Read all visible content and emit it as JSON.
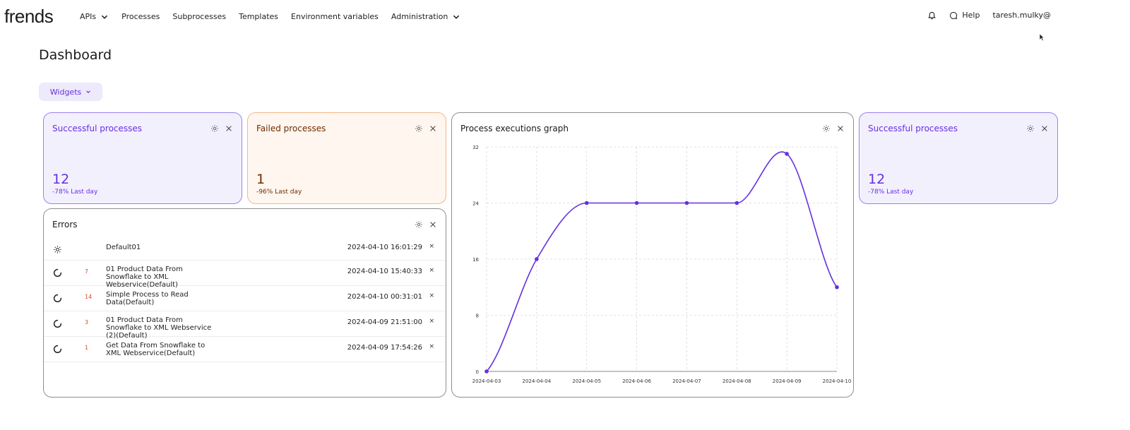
{
  "app": {
    "logo": "frends"
  },
  "nav": {
    "items": [
      {
        "label": "APIs",
        "has_menu": true
      },
      {
        "label": "Processes",
        "has_menu": false
      },
      {
        "label": "Subprocesses",
        "has_menu": false
      },
      {
        "label": "Templates",
        "has_menu": false
      },
      {
        "label": "Environment variables",
        "has_menu": false
      },
      {
        "label": "Administration",
        "has_menu": true
      }
    ],
    "help": "Help",
    "user": "taresh.mulky@"
  },
  "page": {
    "title": "Dashboard"
  },
  "toolbar": {
    "widgets_label": "Widgets"
  },
  "widgets": {
    "success1": {
      "title": "Successful processes",
      "value": "12",
      "sub": "-78% Last day"
    },
    "failed": {
      "title": "Failed processes",
      "value": "1",
      "sub": "-96% Last day"
    },
    "graph": {
      "title": "Process executions graph"
    },
    "success2": {
      "title": "Successful processes",
      "value": "12",
      "sub": "-78% Last day"
    },
    "errors": {
      "title": "Errors",
      "rows": [
        {
          "icon": "gear-icon",
          "count": "",
          "name": "Default01",
          "time": "2024-04-10 16:01:29"
        },
        {
          "icon": "loading-icon",
          "count": "7",
          "name": "01 Product Data From Snowflake to XML Webservice(Default)",
          "time": "2024-04-10 15:40:33"
        },
        {
          "icon": "loading-icon",
          "count": "14",
          "name": "Simple Process to Read Data(Default)",
          "time": "2024-04-10 00:31:01"
        },
        {
          "icon": "loading-icon",
          "count": "3",
          "name": "01 Product Data From Snowflake to XML Webservice (2)(Default)",
          "time": "2024-04-09 21:51:00"
        },
        {
          "icon": "loading-icon",
          "count": "1",
          "name": "Get Data From Snowflake to XML Webservice(Default)",
          "time": "2024-04-09 17:54:26"
        }
      ],
      "close_glyph": "×"
    }
  },
  "colors": {
    "accent": "#6530e0",
    "failed": "#6e2c00",
    "error_count": "#e0442c"
  },
  "chart_data": {
    "type": "line",
    "title": "Process executions graph",
    "x": [
      "2024-04-03",
      "2024-04-04",
      "2024-04-05",
      "2024-04-06",
      "2024-04-07",
      "2024-04-08",
      "2024-04-09",
      "2024-04-10"
    ],
    "series": [
      {
        "values": [
          0,
          16,
          24,
          24,
          24,
          24,
          31,
          12
        ]
      }
    ],
    "y_ticks": [
      0,
      8,
      16,
      24,
      32
    ],
    "ylim": [
      0,
      32
    ],
    "grid": true,
    "line_color": "#6530e0"
  }
}
